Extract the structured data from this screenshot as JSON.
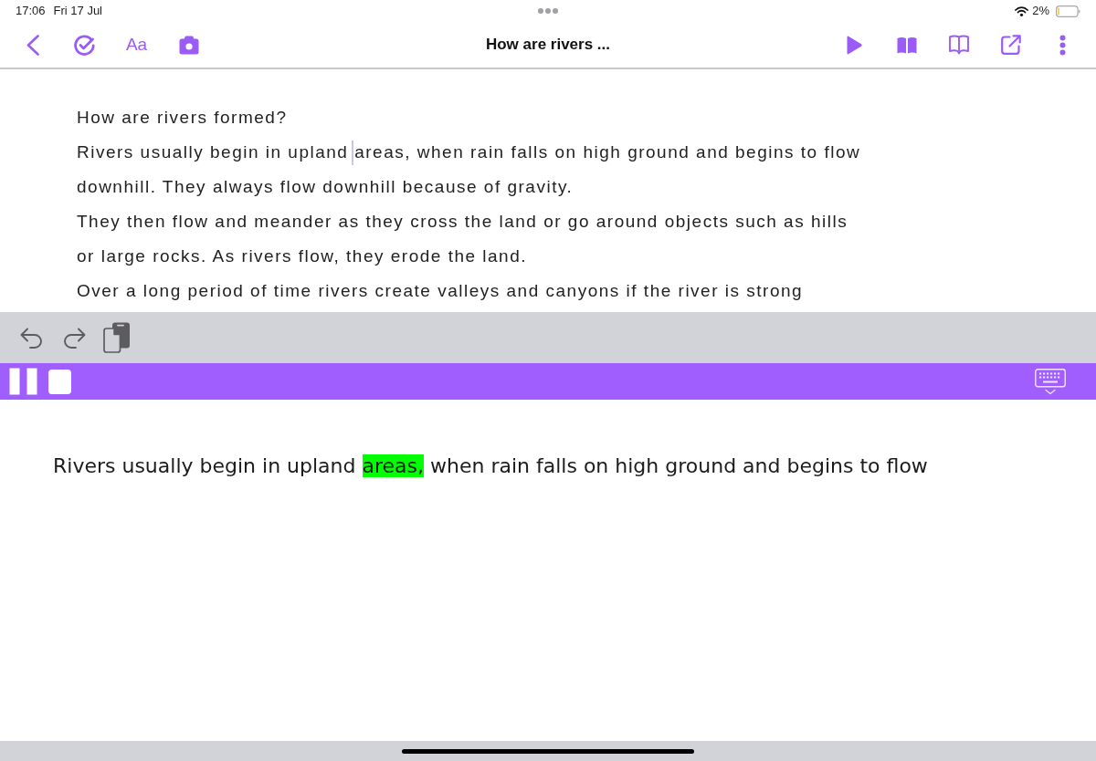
{
  "status_bar": {
    "time": "17:06",
    "date": "Fri 17 Jul",
    "battery": "2%"
  },
  "nav_bar": {
    "text_style_button": "Aa",
    "title": "How are rivers ..."
  },
  "document": {
    "lines": [
      {
        "kind": "text",
        "text": "How are rivers formed?"
      },
      {
        "kind": "cursor",
        "text_before_cursor": "Rivers usually begin in upland ",
        "text_after_cursor": "areas, when rain falls on high ground and begins to flow"
      },
      {
        "kind": "text",
        "text": "downhill. They always flow downhill because of gravity."
      },
      {
        "kind": "text",
        "text": "They then flow and meander as they cross the land or go around objects such as hills"
      },
      {
        "kind": "text",
        "text": "or large rocks. As rivers flow, they erode the land."
      },
      {
        "kind": "text",
        "text": "Over a long period of time rivers create valleys and canyons if the river is strong"
      }
    ]
  },
  "reader": {
    "text_before": "Rivers usually begin in upland",
    "current_word": "areas,",
    "text_after": "when rain falls on high ground and begins to flow"
  }
}
